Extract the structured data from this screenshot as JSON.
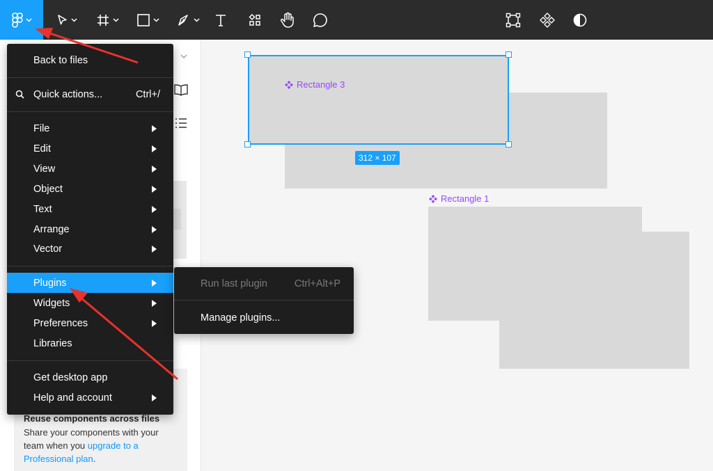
{
  "toolbar": {
    "logo_icon": "figma-logo-icon",
    "tools": [
      "move-tool-icon",
      "frame-tool-icon",
      "shape-tool-icon",
      "pen-tool-icon",
      "text-tool-icon",
      "resources-icon",
      "hand-tool-icon",
      "comment-tool-icon"
    ],
    "right_tools": [
      "component-edit-icon",
      "components-icon",
      "contrast-icon"
    ],
    "accent": "#18a0fb"
  },
  "main_menu": {
    "back": "Back to files",
    "quick_actions": {
      "label": "Quick actions...",
      "shortcut": "Ctrl+/"
    },
    "items": [
      {
        "label": "File"
      },
      {
        "label": "Edit"
      },
      {
        "label": "View"
      },
      {
        "label": "Object"
      },
      {
        "label": "Text"
      },
      {
        "label": "Arrange"
      },
      {
        "label": "Vector"
      }
    ],
    "plugins": "Plugins",
    "widgets": "Widgets",
    "preferences": "Preferences",
    "libraries": "Libraries",
    "desktop_app": "Get desktop app",
    "help": "Help and account"
  },
  "plugins_submenu": {
    "run_last": {
      "label": "Run last plugin",
      "shortcut": "Ctrl+Alt+P"
    },
    "manage": "Manage plugins..."
  },
  "left_panel": {
    "promo_title": "Reuse components across files",
    "promo_body": "Share your components with your team when you ",
    "promo_link": "upgrade to a Professional plan",
    "promo_end": "."
  },
  "canvas": {
    "component_a": "Rectangle 3",
    "component_b": "Rectangle 1",
    "dimensions": "312 × 107"
  }
}
